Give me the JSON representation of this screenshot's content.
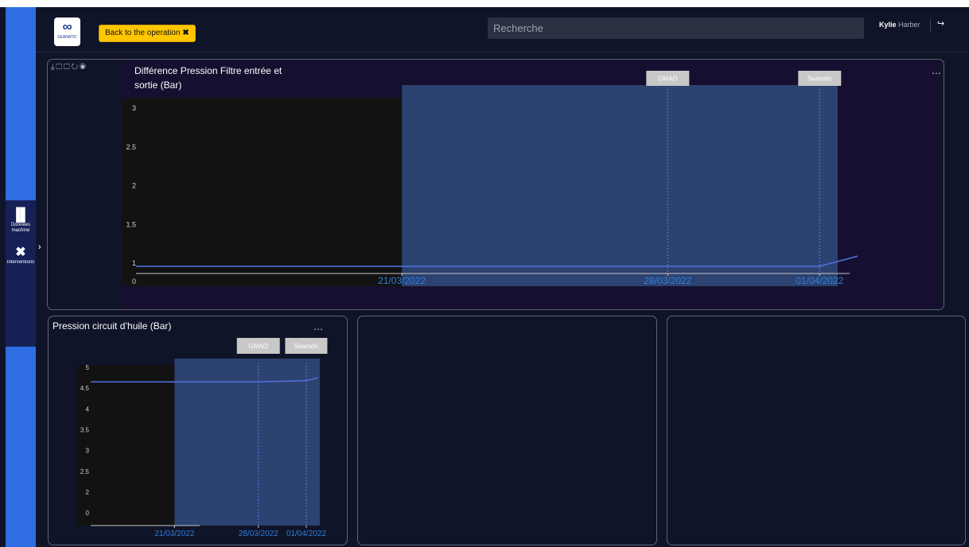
{
  "sidebar": {
    "items": [
      {
        "icon": "chart-bar-icon",
        "label_line1": "Données",
        "label_line2": "machine"
      },
      {
        "icon": "tools-icon",
        "label": "Interventions"
      }
    ]
  },
  "header": {
    "logo_text": "SEANATIC",
    "back_button": "Back to the operation",
    "search_placeholder": "Recherche",
    "user_first": "Kylie",
    "user_last": "Harber"
  },
  "chart_data": [
    {
      "type": "line",
      "title_line1": "Différence Pression Filtre entrée et",
      "title_line2": "sortie (Bar)",
      "x": [
        "2022-03-14",
        "2022-03-21",
        "2022-03-28",
        "2022-04-01",
        "2022-04-02"
      ],
      "xticks": [
        "21/03/2022",
        "28/03/2022",
        "01/04/2022"
      ],
      "yticks": [
        "0",
        "1",
        "1.5",
        "2",
        "2.5",
        "3"
      ],
      "series": [
        {
          "values": [
            0.96,
            0.96,
            0.96,
            0.96,
            1.09
          ]
        }
      ],
      "annotations": [
        "GMAO",
        "Seanatic"
      ],
      "colors": {
        "line": "#4f6fd8",
        "highlight": "#2c4270",
        "plot": "#121212"
      }
    },
    {
      "type": "line",
      "title": "Pression circuit d’huile (Bar)",
      "x": [
        "2022-03-14",
        "2022-03-21",
        "2022-03-28",
        "2022-04-01",
        "2022-04-02"
      ],
      "xticks": [
        "21/03/2022",
        "28/03/2022",
        "01/04/2022"
      ],
      "yticks": [
        "0",
        "2",
        "2.5",
        "3",
        "3.5",
        "4",
        "4.5",
        "5"
      ],
      "series": [
        {
          "values": [
            4.65,
            4.65,
            4.65,
            4.68,
            4.75
          ]
        }
      ],
      "annotations": [
        "GMAO",
        "Seanatic"
      ],
      "colors": {
        "line": "#4f6fd8",
        "highlight": "#2c4270",
        "plot": "#121212"
      }
    }
  ]
}
